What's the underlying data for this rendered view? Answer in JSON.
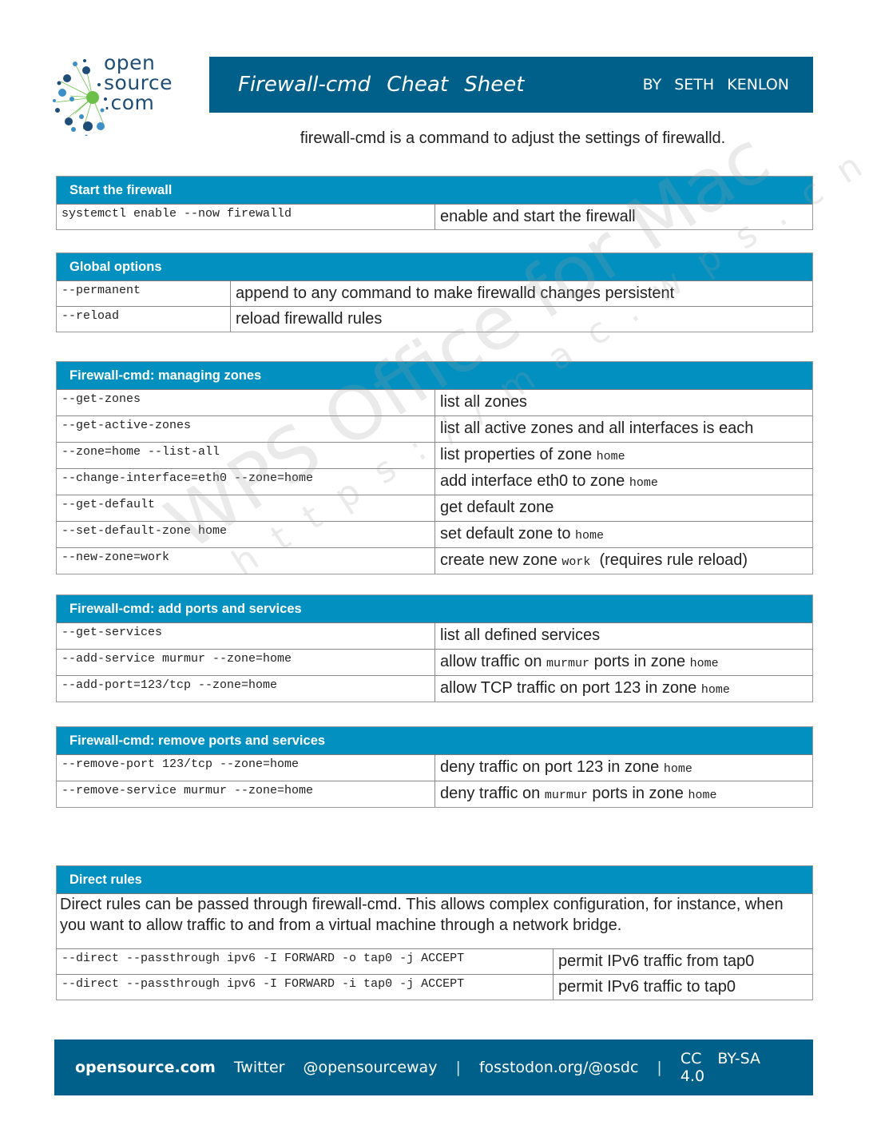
{
  "logo": {
    "lines": [
      "open",
      "source",
      ".com"
    ]
  },
  "header": {
    "title": "Firewall-cmd Cheat Sheet",
    "author": "BY SETH KENLON"
  },
  "subtitle": "firewall-cmd is a command to adjust the settings of firewalld.",
  "sections": [
    {
      "title": "Start the firewall",
      "rows": [
        {
          "cmd": "systemctl enable --now firewalld",
          "desc": "enable and start the firewall"
        }
      ]
    },
    {
      "title": "Global options",
      "rows": [
        {
          "cmd": "--permanent",
          "desc": "append to any command to make firewalld changes persistent"
        },
        {
          "cmd": "--reload",
          "desc": "reload firewalld rules"
        }
      ]
    },
    {
      "title": "Firewall-cmd: managing zones",
      "rows": [
        {
          "cmd": "--get-zones",
          "desc": "list all zones"
        },
        {
          "cmd": "--get-active-zones",
          "desc": "list all active zones and all interfaces is each"
        },
        {
          "cmd": "--zone=home --list-all",
          "desc": "list properties of zone ",
          "code": "home"
        },
        {
          "cmd": "--change-interface=eth0 --zone=home",
          "desc": "add interface eth0 to zone ",
          "code": "home"
        },
        {
          "cmd": "--get-default",
          "desc": "get default zone"
        },
        {
          "cmd": "--set-default-zone home",
          "desc": "set default zone to ",
          "code": "home"
        },
        {
          "cmd": "--new-zone=work",
          "desc": "create new zone ",
          "code": "work",
          "after": "  (requires rule reload)"
        }
      ]
    },
    {
      "title": "Firewall-cmd: add ports and services",
      "rows": [
        {
          "cmd": "--get-services",
          "desc": "list all defined services"
        },
        {
          "cmd": "--add-service murmur --zone=home",
          "desc": "allow traffic on ",
          "code": "murmur",
          "after": " ports in zone ",
          "code2": "home"
        },
        {
          "cmd": "--add-port=123/tcp --zone=home",
          "desc": "allow TCP traffic on port 123 in zone ",
          "code": "home"
        }
      ]
    },
    {
      "title": "Firewall-cmd: remove ports and services",
      "rows": [
        {
          "cmd": "--remove-port 123/tcp --zone=home",
          "desc": "deny traffic on port 123 in zone ",
          "code": "home"
        },
        {
          "cmd": "--remove-service murmur --zone=home",
          "desc": "deny traffic on ",
          "code": "murmur",
          "after": " ports in zone ",
          "code2": "home"
        }
      ]
    },
    {
      "title": "Direct rules",
      "paragraph": "Direct rules can be passed through firewall-cmd. This allows complex configuration, for instance, when you want to allow traffic to and from a virtual machine through a network bridge.",
      "rows": [
        {
          "cmd": "--direct --passthrough ipv6 -I FORWARD -o tap0 -j ACCEPT",
          "desc": "permit IPv6 traffic from tap0"
        },
        {
          "cmd": "--direct --passthrough ipv6 -I FORWARD -i tap0 -j ACCEPT",
          "desc": "permit IPv6 traffic to tap0"
        }
      ]
    }
  ],
  "footer": {
    "brand": "opensource.com",
    "twitter_label": "Twitter",
    "twitter_handle": "@opensourceway",
    "separator": "|",
    "mastodon": "fosstodon.org/@osdc",
    "license": "CC BY-SA 4.0"
  },
  "watermark": {
    "line1": "WPS Office for Mac",
    "line2": "https://mac.wps.cn/"
  },
  "colors": {
    "title_bar": "#01608a",
    "section_header": "#0190c0",
    "logo_text": "#1e4d78",
    "logo_center": "#6cc04a"
  }
}
